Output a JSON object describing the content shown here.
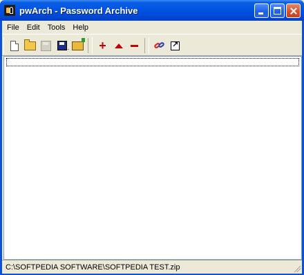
{
  "window": {
    "title": "pwArch - Password Archive",
    "icon": "app-keyring-icon",
    "accent_color": "#0054e3"
  },
  "menubar": {
    "items": [
      {
        "label": "File"
      },
      {
        "label": "Edit"
      },
      {
        "label": "Tools"
      },
      {
        "label": "Help"
      }
    ]
  },
  "toolbar": {
    "buttons": [
      {
        "icon": "new-document-icon",
        "enabled": true
      },
      {
        "icon": "open-folder-icon",
        "enabled": true
      },
      {
        "icon": "save-icon",
        "enabled": false
      },
      {
        "icon": "save-as-icon",
        "enabled": true
      },
      {
        "icon": "export-folder-icon",
        "enabled": true
      },
      {
        "icon": "add-icon",
        "enabled": true
      },
      {
        "icon": "move-up-icon",
        "enabled": true
      },
      {
        "icon": "remove-icon",
        "enabled": true
      },
      {
        "icon": "link-icon",
        "enabled": true
      },
      {
        "icon": "shortcut-icon",
        "enabled": true
      }
    ]
  },
  "statusbar": {
    "text": "C:\\SOFTPEDIA SOFTWARE\\SOFTPEDIA TEST.zip"
  }
}
